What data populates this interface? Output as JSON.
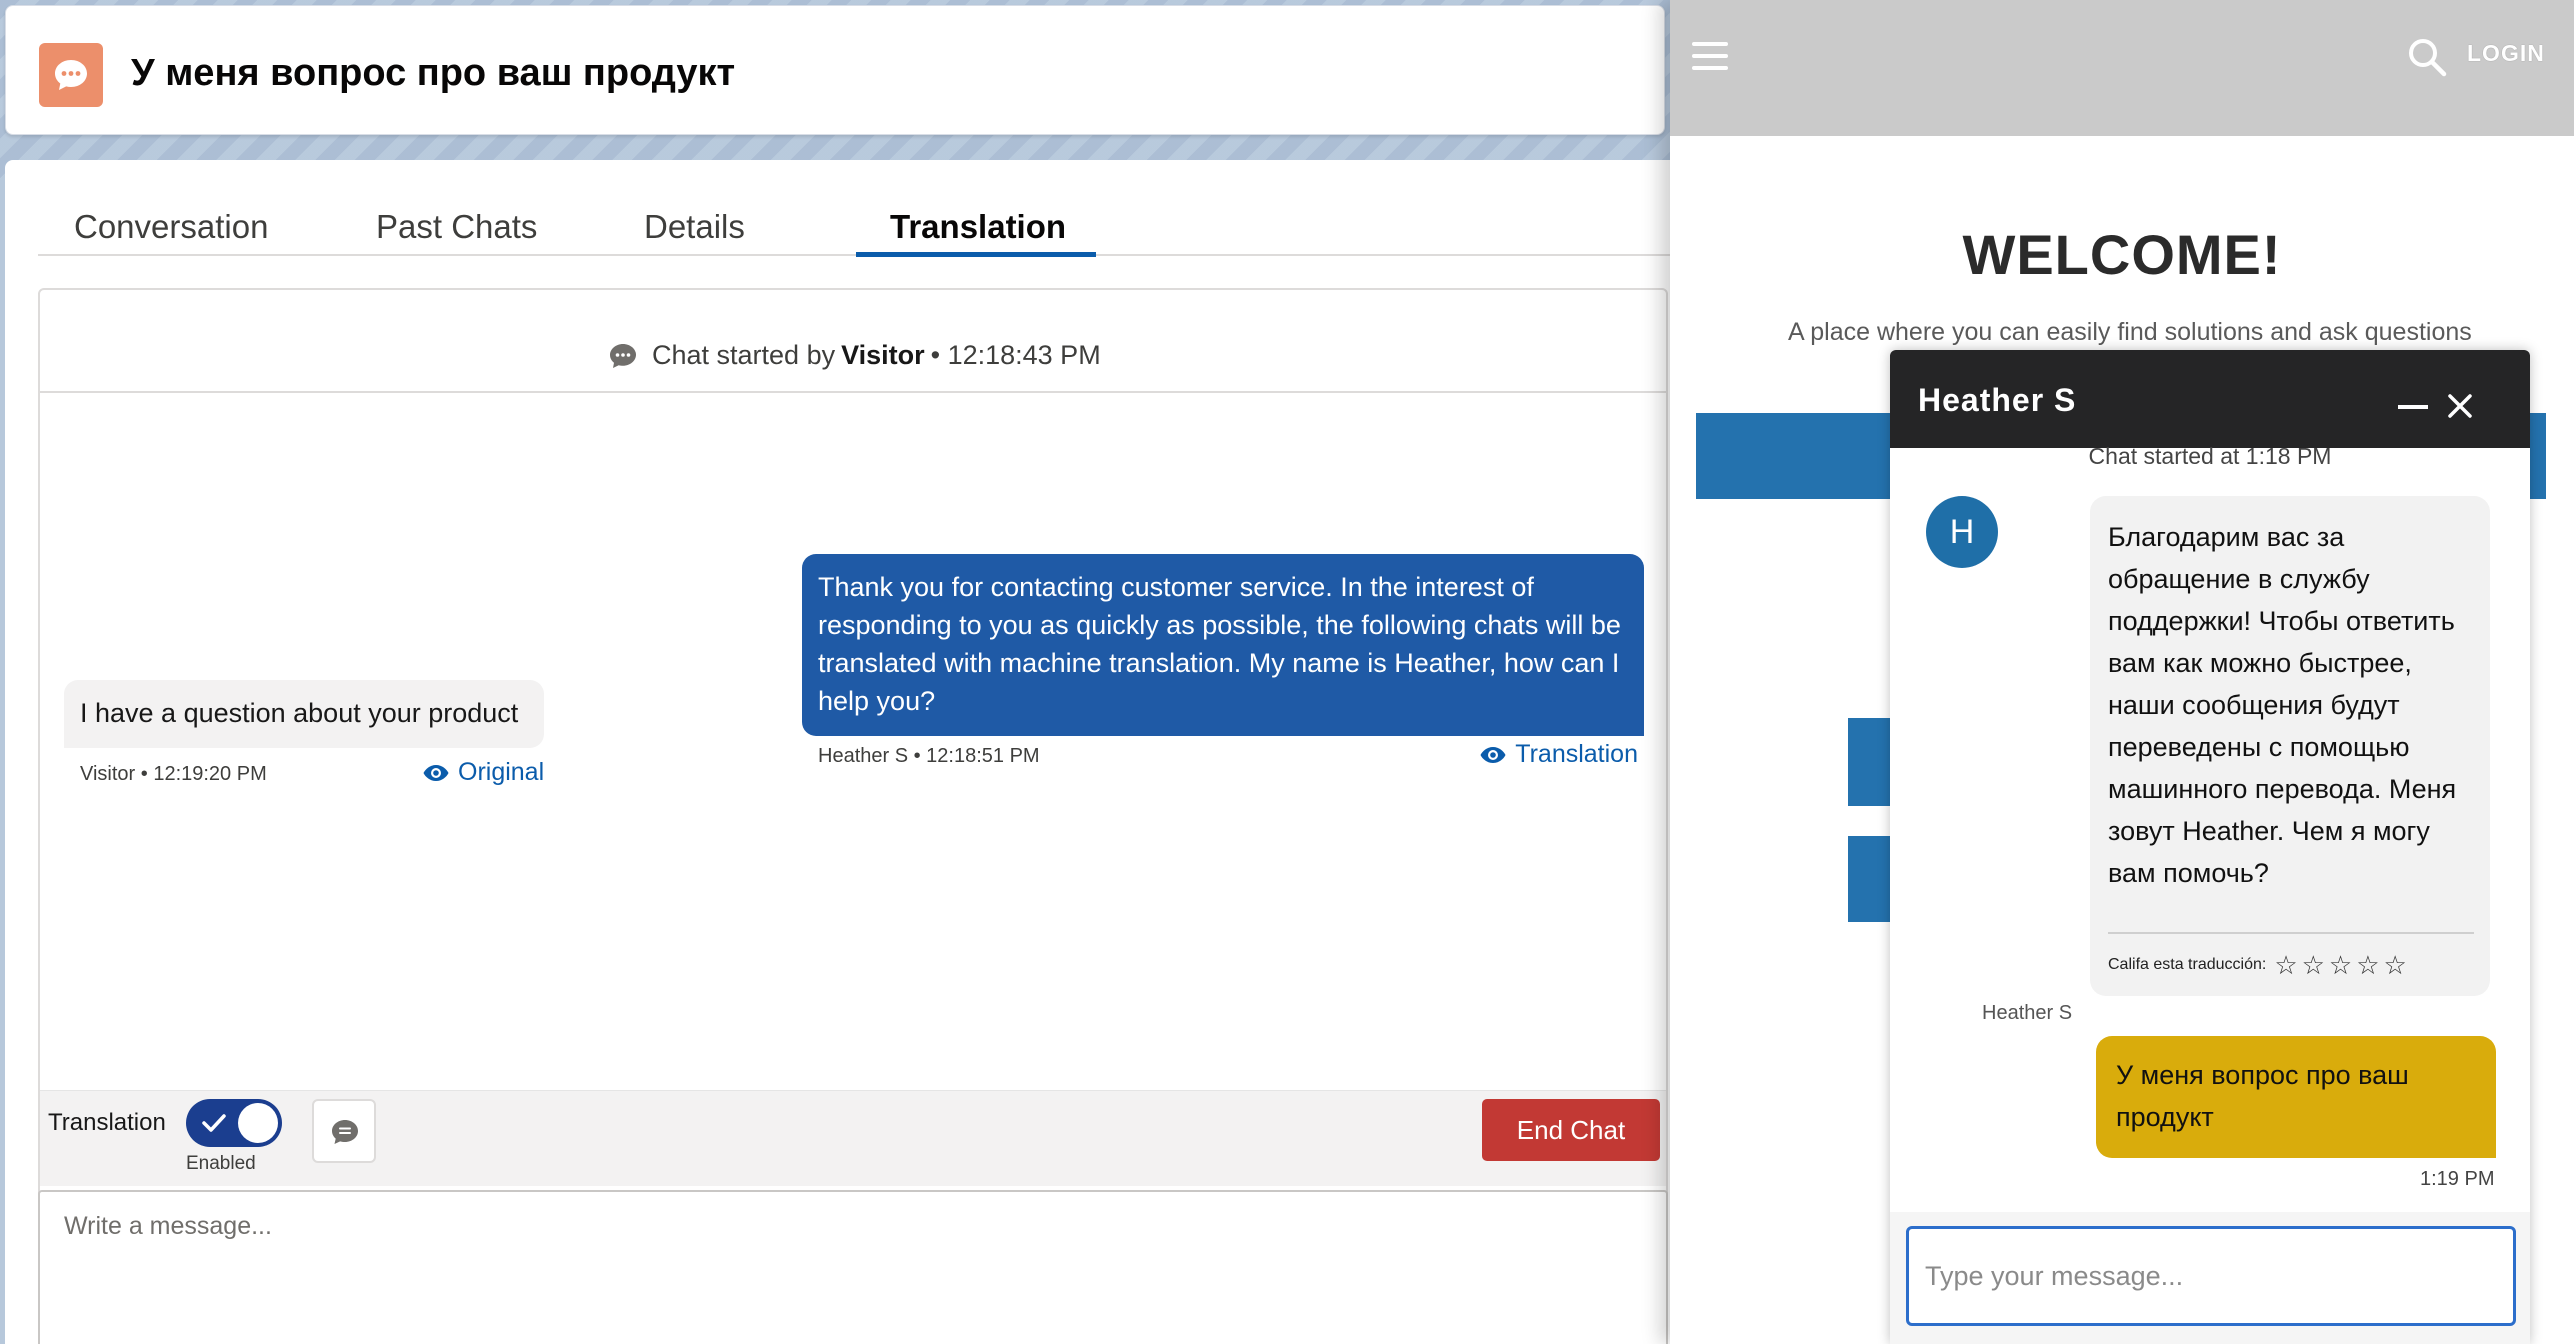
{
  "console": {
    "record_title": "У меня вопрос про ваш продукт",
    "tabs": [
      {
        "label": "Conversation"
      },
      {
        "label": "Past Chats"
      },
      {
        "label": "Details"
      },
      {
        "label": "Translation"
      }
    ],
    "active_tab": "Translation",
    "chat_start": {
      "prefix": "Chat started by",
      "who": "Visitor",
      "time": "• 12:18:43 PM"
    },
    "messages": {
      "agent": {
        "text": "Thank you for contacting customer service. In the interest of responding to you as quickly as possible, the following chats will be translated with machine translation. My name is Heather, how can I help you?",
        "meta": "Heather S • 12:18:51 PM",
        "toggle_label": "Translation"
      },
      "visitor": {
        "text": "I have a question about your product",
        "meta": "Visitor • 12:19:20 PM",
        "toggle_label": "Original"
      }
    },
    "toolbar": {
      "translation_label": "Translation",
      "toggle_state": "Enabled",
      "end_chat_label": "End Chat"
    },
    "composer": {
      "placeholder": "Write a message...",
      "value": ""
    }
  },
  "site": {
    "login_label": "LOGIN",
    "welcome": "WELCOME!",
    "tagline": "A place where you can easily find solutions and ask questions",
    "bar_color": "#2472ae"
  },
  "widget": {
    "agent_name": "Heather S",
    "chat_started": "Chat started at 1:18 PM",
    "avatar_initial": "H",
    "agent_message": "Благодарим вас за обращение в службу поддержки! Чтобы ответить вам как можно быстрее, наши сообщения будут переведены с помощью машинного перевода. Меня зовут Heather. Чем я могу вам помочь?",
    "rate_label": "Califa esta traducción:",
    "rate_stars": "☆☆☆☆☆",
    "message_sender": "Heather S",
    "user_message": "У меня вопрос про ваш продукт",
    "user_time": "1:19 PM",
    "input": {
      "placeholder": "Type your message...",
      "value": ""
    },
    "user_bubble_color": "#d9ac0c",
    "header_color": "#252526"
  },
  "colors": {
    "agent_bubble": "#1f5aa6",
    "end_chat": "#c23934",
    "record_icon": "#ec8f6b",
    "link": "#0b5cab"
  },
  "icons": [
    "chat-record-icon",
    "chat-bubble-icon",
    "eye-icon",
    "check-icon",
    "quick-text-icon",
    "menu-icon",
    "search-icon",
    "minimize-icon",
    "close-icon"
  ]
}
